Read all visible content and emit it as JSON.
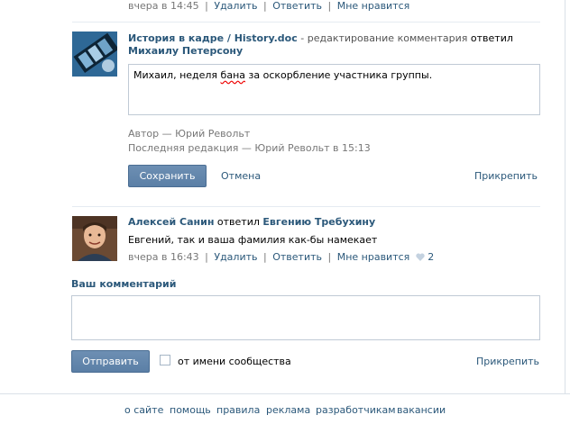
{
  "top_comment": {
    "time": "вчера в 14:45",
    "actions": [
      "Удалить",
      "Ответить",
      "Мне нравится"
    ]
  },
  "edit_comment": {
    "group_title": "История в кадре / History.doc",
    "editing_text": "- редактирование комментария",
    "replied_word": "ответил",
    "replied_to": "Михаилу Петерсону",
    "text_before": "Михаил, неделя ",
    "text_error": "бана",
    "text_after": " за оскорбление участника группы.",
    "author_line": "Автор — Юрий Револьт",
    "last_edit_line": "Последняя редакция — Юрий Револьт в 15:13",
    "save_label": "Сохранить",
    "cancel_label": "Отмена",
    "attach_label": "Прикрепить"
  },
  "comment": {
    "author": "Алексей Санин",
    "replied_word": "ответил",
    "replied_to": "Евгению Требухину",
    "text": "Евгений, так и ваша фамилия как-бы намекает",
    "time": "вчера в 16:43",
    "actions": [
      "Удалить",
      "Ответить",
      "Мне нравится"
    ],
    "likes": "2"
  },
  "new_comment": {
    "label": "Ваш комментарий",
    "send_label": "Отправить",
    "as_community_label": "от имени сообщества",
    "attach_label": "Прикрепить"
  },
  "footer": {
    "links": [
      "о сайте",
      "помощь",
      "правила",
      "реклама",
      "разработчикам",
      "вакансии"
    ]
  },
  "colors": {
    "link": "#2b587a",
    "button": "#5b7fa6",
    "divider": "#e5ebf1"
  }
}
